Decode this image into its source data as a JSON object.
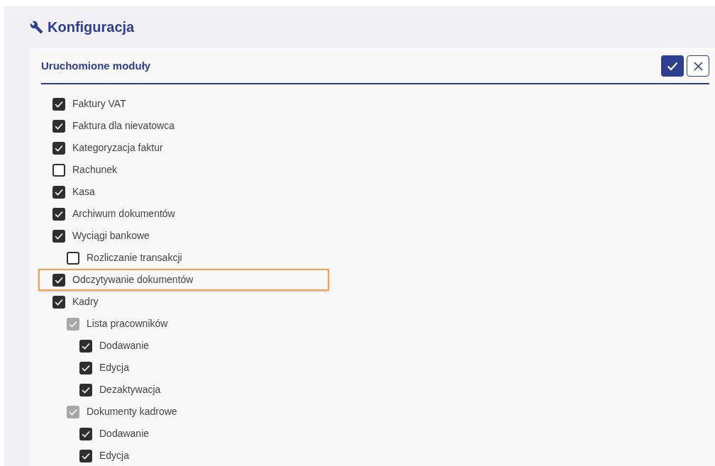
{
  "page": {
    "title": "Konfiguracja"
  },
  "panel": {
    "title": "Uruchomione moduły"
  },
  "modules": [
    {
      "label": "Faktury VAT",
      "checked": true,
      "disabled": false,
      "highlighted": false
    },
    {
      "label": "Faktura dla nievatowca",
      "checked": true,
      "disabled": false,
      "highlighted": false
    },
    {
      "label": "Kategoryzacja faktur",
      "checked": true,
      "disabled": false,
      "highlighted": false
    },
    {
      "label": "Rachunek",
      "checked": false,
      "disabled": false,
      "highlighted": false
    },
    {
      "label": "Kasa",
      "checked": true,
      "disabled": false,
      "highlighted": false
    },
    {
      "label": "Archiwum dokumentów",
      "checked": true,
      "disabled": false,
      "highlighted": false
    },
    {
      "label": "Wyciągi bankowe",
      "checked": true,
      "disabled": false,
      "highlighted": false,
      "children": [
        {
          "label": "Rozliczanie transakcji",
          "checked": false,
          "disabled": false,
          "highlighted": false
        }
      ]
    },
    {
      "label": "Odczytywanie dokumentów",
      "checked": true,
      "disabled": false,
      "highlighted": true
    },
    {
      "label": "Kadry",
      "checked": true,
      "disabled": false,
      "highlighted": false,
      "children": [
        {
          "label": "Lista pracowników",
          "checked": true,
          "disabled": true,
          "highlighted": false,
          "children": [
            {
              "label": "Dodawanie",
              "checked": true,
              "disabled": false,
              "highlighted": false
            },
            {
              "label": "Edycja",
              "checked": true,
              "disabled": false,
              "highlighted": false
            },
            {
              "label": "Dezaktywacja",
              "checked": true,
              "disabled": false,
              "highlighted": false
            }
          ]
        },
        {
          "label": "Dokumenty kadrowe",
          "checked": true,
          "disabled": true,
          "highlighted": false,
          "children": [
            {
              "label": "Dodawanie",
              "checked": true,
              "disabled": false,
              "highlighted": false
            },
            {
              "label": "Edycja",
              "checked": true,
              "disabled": false,
              "highlighted": false
            }
          ]
        }
      ]
    }
  ]
}
